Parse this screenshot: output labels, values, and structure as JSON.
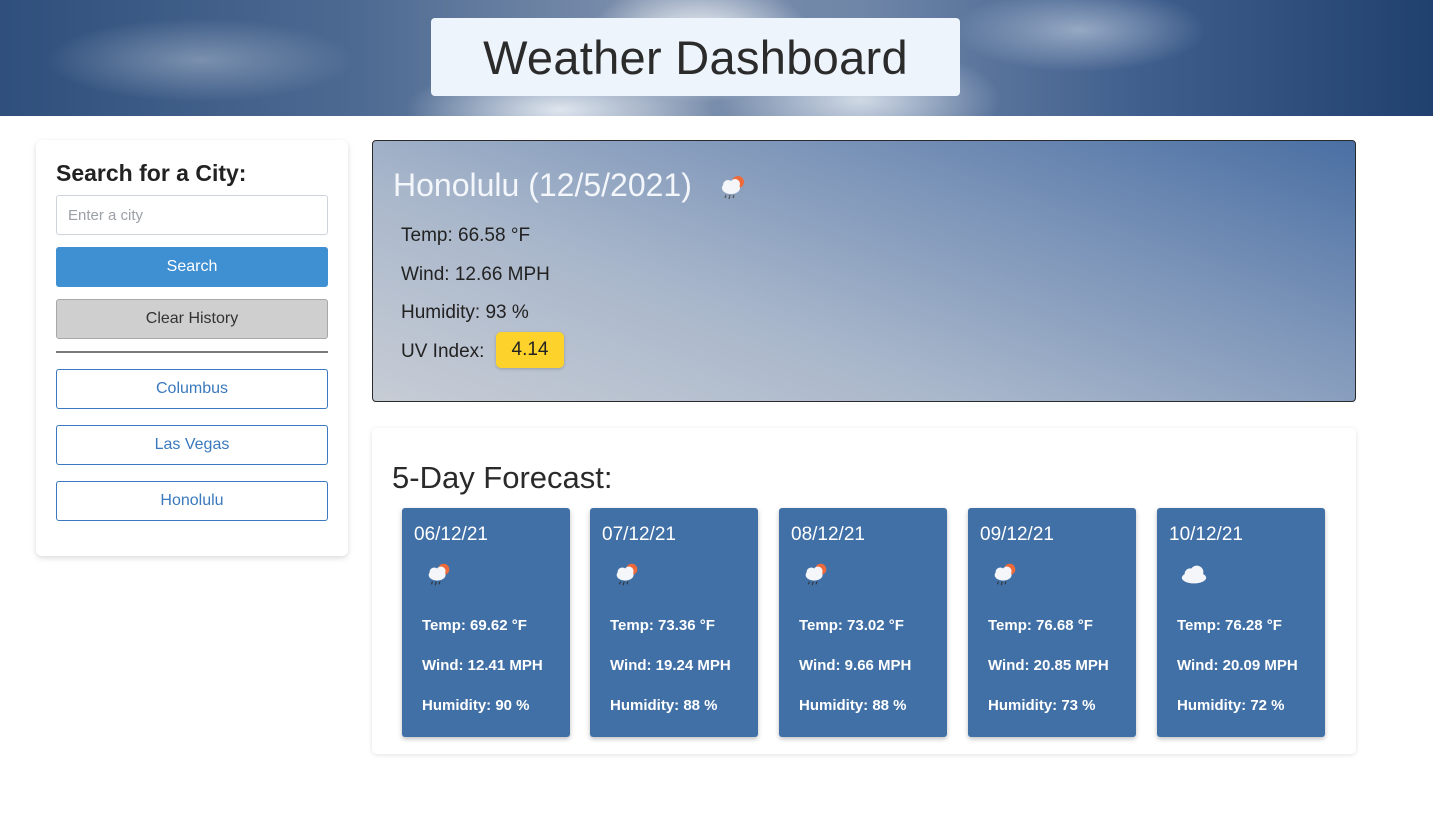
{
  "header": {
    "title": "Weather Dashboard"
  },
  "sidebar": {
    "heading": "Search for a City:",
    "search_placeholder": "Enter a city",
    "search_value": "",
    "search_button": "Search",
    "clear_button": "Clear History",
    "history": [
      "Columbus",
      "Las Vegas",
      "Honolulu"
    ]
  },
  "current": {
    "title": "Honolulu (12/5/2021)",
    "icon": "rain-sun-icon",
    "temp": "Temp: 66.58 °F",
    "wind": "Wind: 12.66 MPH",
    "humidity": "Humidity: 93 %",
    "uv_label": "UV Index:",
    "uv_value": "4.14",
    "uv_color": "#fcd22b"
  },
  "forecast": {
    "heading": "5-Day Forecast:",
    "days": [
      {
        "date": "06/12/21",
        "icon": "rain-sun-icon",
        "temp": "Temp: 69.62 °F",
        "wind": "Wind: 12.41 MPH",
        "humidity": "Humidity: 90 %"
      },
      {
        "date": "07/12/21",
        "icon": "rain-sun-icon",
        "temp": "Temp: 73.36 °F",
        "wind": "Wind: 19.24 MPH",
        "humidity": "Humidity: 88 %"
      },
      {
        "date": "08/12/21",
        "icon": "rain-sun-icon",
        "temp": "Temp: 73.02 °F",
        "wind": "Wind: 9.66 MPH",
        "humidity": "Humidity: 88 %"
      },
      {
        "date": "09/12/21",
        "icon": "rain-sun-icon",
        "temp": "Temp: 76.68 °F",
        "wind": "Wind: 20.85 MPH",
        "humidity": "Humidity: 73 %"
      },
      {
        "date": "10/12/21",
        "icon": "cloud-icon",
        "temp": "Temp: 76.28 °F",
        "wind": "Wind: 20.09 MPH",
        "humidity": "Humidity: 72 %"
      }
    ]
  },
  "colors": {
    "card": "#4070a6",
    "search_button": "#3f8fd3",
    "history_button": "#3a79bd"
  }
}
